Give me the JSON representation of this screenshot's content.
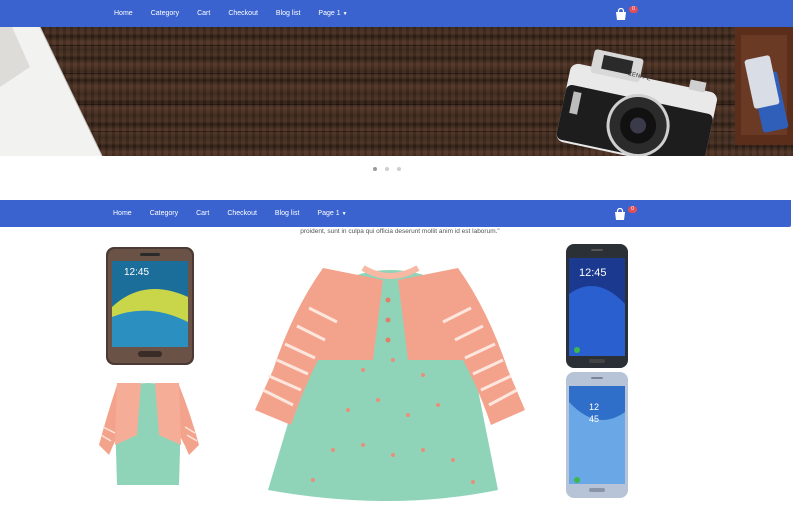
{
  "nav": {
    "items": [
      "Home",
      "Category",
      "Cart",
      "Checkout",
      "Blog list",
      "Page 1"
    ],
    "cart_count": "0"
  },
  "nav_second": {
    "items": [
      "Home",
      "Category",
      "Cart",
      "Checkout",
      "Blog list",
      "Page 1"
    ],
    "cart_count": "0"
  },
  "carousel": {
    "slide_count": 3,
    "active_index": 0
  },
  "product_caption": "proident, sunt in culpa qui officia deserunt mollit anim id est laborum.\"",
  "camera_brand": "ZENIT-E",
  "colors": {
    "navbar": "#3b63cf",
    "badge": "#e0505a",
    "cardigan": "#f3a38c",
    "dress": "#8fd4b8"
  },
  "icons": [
    "shopping-bag-icon",
    "caret-down-icon"
  ]
}
